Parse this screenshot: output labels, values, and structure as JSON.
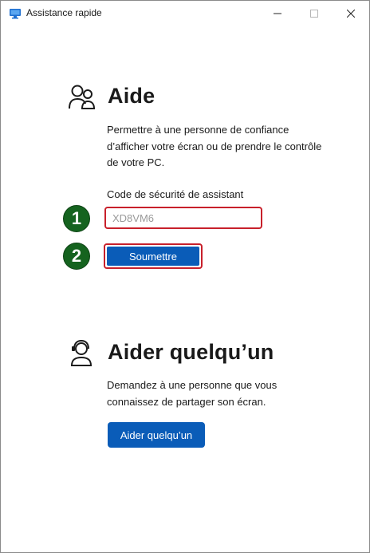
{
  "window": {
    "title": "Assistance rapide",
    "controls": {
      "minimize": "—",
      "maximize": "☐",
      "close": "✕"
    }
  },
  "help_section": {
    "icon": "people-icon",
    "heading": "Aide",
    "description": "Permettre à une personne de confiance d’afficher votre écran ou de prendre le contrôle de votre PC.",
    "code_label": "Code de sécurité de assistant",
    "code_value": "XD8VM6",
    "submit_label": "Soumettre"
  },
  "annotations": {
    "step1": "1",
    "step2": "2",
    "badge_color": "#15631f",
    "highlight_color": "#c8202b"
  },
  "assist_section": {
    "icon": "person-headset-icon",
    "heading": "Aider quelqu’un",
    "description": "Demandez à une personne que vous connaissez de partager son écran.",
    "button_label": "Aider quelqu’un"
  },
  "colors": {
    "accent": "#0a5cb8"
  }
}
